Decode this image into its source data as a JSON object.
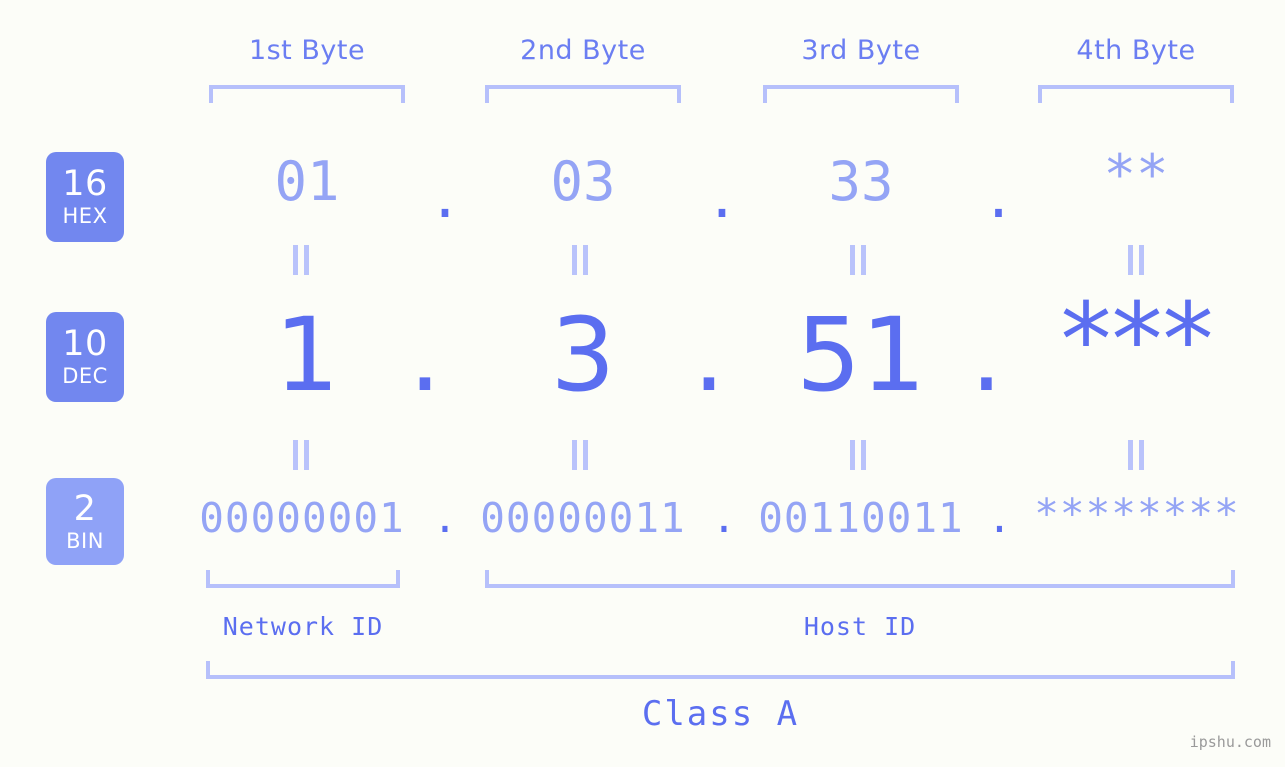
{
  "watermark": "ipshu.com",
  "byte_headers": [
    {
      "label": "1st Byte"
    },
    {
      "label": "2nd Byte"
    },
    {
      "label": "3rd Byte"
    },
    {
      "label": "4th Byte"
    }
  ],
  "bases": [
    {
      "number": "16",
      "name": "HEX",
      "color": "#7287ef"
    },
    {
      "number": "10",
      "name": "DEC",
      "color": "#7287ef"
    },
    {
      "number": "2",
      "name": "BIN",
      "color": "#8fa2f7"
    }
  ],
  "rows": {
    "hex": {
      "base_number": "16",
      "base_name": "HEX",
      "values": [
        "01",
        "03",
        "33",
        "**"
      ],
      "separators": [
        ".",
        ".",
        "."
      ]
    },
    "dec": {
      "base_number": "10",
      "base_name": "DEC",
      "values": [
        "1",
        "3",
        "51",
        "***"
      ],
      "separators": [
        ".",
        ".",
        "."
      ]
    },
    "bin": {
      "base_number": "2",
      "base_name": "BIN",
      "values": [
        "00000001",
        "00000011",
        "00110011",
        "********"
      ],
      "separators": [
        ".",
        ".",
        "."
      ]
    }
  },
  "equivalence_mark": "||",
  "sections": [
    {
      "label": "Network ID"
    },
    {
      "label": "Host ID"
    }
  ],
  "class_label": "Class A",
  "colors": {
    "background": "#fcfdf8",
    "accent_strong": "#5b6ef0",
    "accent_light": "#94a4f5",
    "bracket": "#b6c0fb",
    "badge_dark": "#7287ef",
    "badge_light": "#8fa2f7",
    "watermark": "#9a9a9a"
  }
}
